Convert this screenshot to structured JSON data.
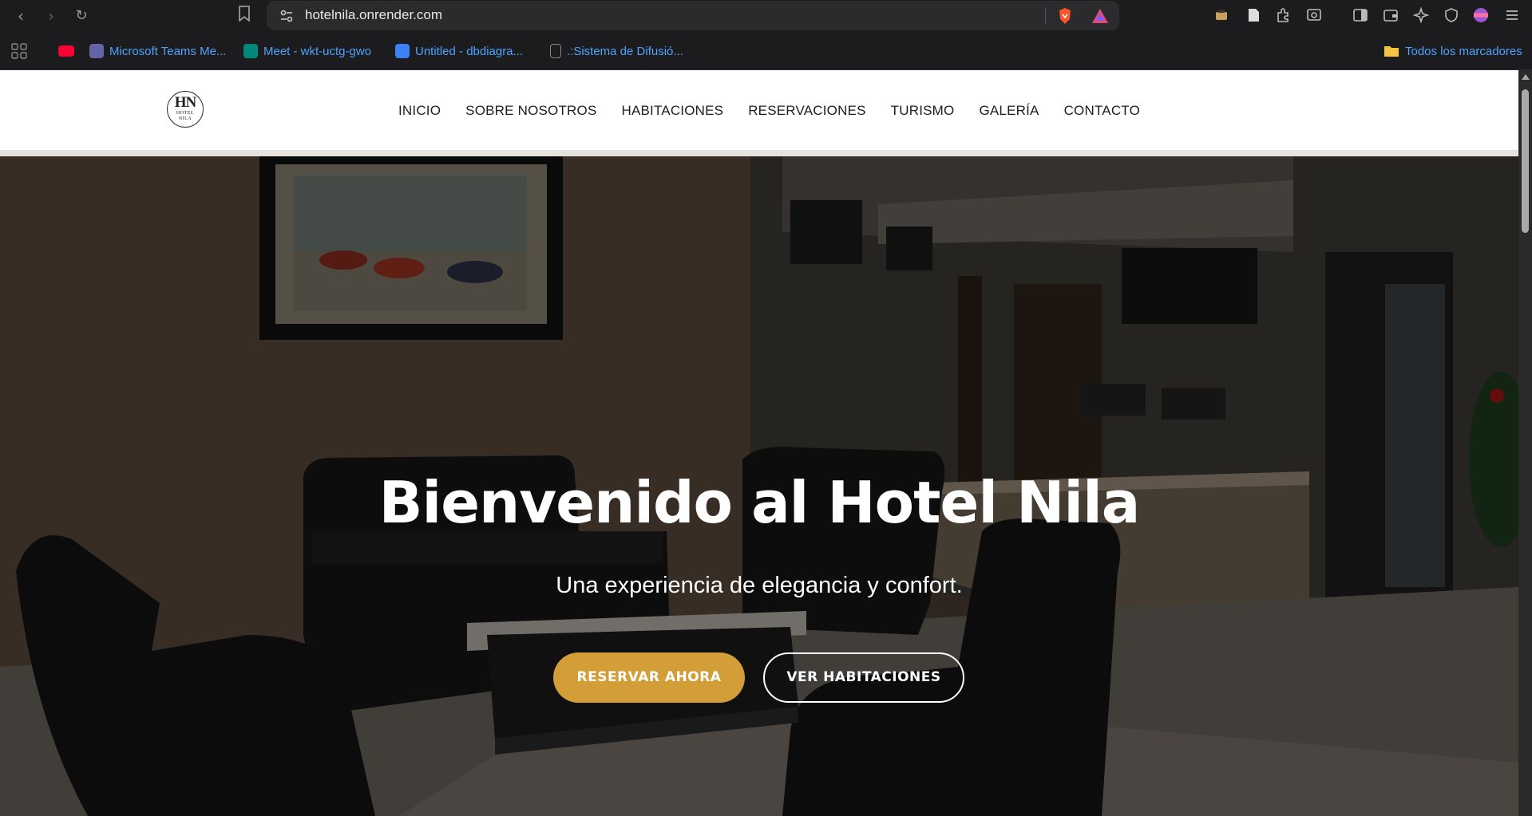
{
  "browser": {
    "url": "hotelnila.onrender.com",
    "bookmarks": [
      {
        "label": "",
        "icon": "youtube-icon",
        "color": "#ff0033"
      },
      {
        "label": "Microsoft Teams Me...",
        "icon": "teams-icon",
        "color": "#6264a7"
      },
      {
        "label": "Meet - wkt-uctg-gwo",
        "icon": "meet-icon",
        "color": "#00897b"
      },
      {
        "label": "Untitled - dbdiagra...",
        "icon": "dbdiagram-icon",
        "color": "#3b82f6"
      },
      {
        "label": ".:Sistema de Difusió...",
        "icon": "sistema-icon",
        "color": "#cccccc"
      }
    ],
    "all_bookmarks_label": "Todos los marcadores"
  },
  "site": {
    "logo": {
      "initials": "HN",
      "line1": "HOTEL",
      "line2": "NILA"
    },
    "menu": [
      "INICIO",
      "SOBRE NOSOTROS",
      "HABITACIONES",
      "RESERVACIONES",
      "TURISMO",
      "GALERÍA",
      "CONTACTO"
    ],
    "theme_toggle_icon": "moon-icon"
  },
  "hero": {
    "title": "Bienvenido al Hotel Nila",
    "subtitle": "Una experiencia de elegancia y confort.",
    "primary_button": "RESERVAR AHORA",
    "secondary_button": "VER HABITACIONES",
    "accent_color": "#d39e37"
  }
}
